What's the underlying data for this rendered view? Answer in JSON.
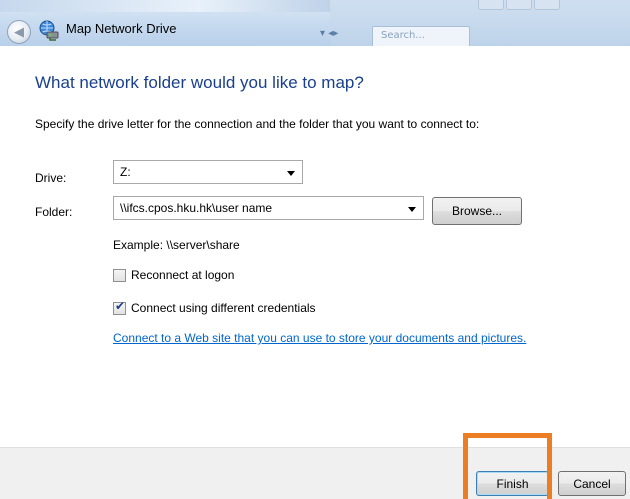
{
  "window": {
    "title": "Map Network Drive",
    "search_placeholder": "Search..."
  },
  "dialog": {
    "heading": "What network folder would you like to map?",
    "instruction": "Specify the drive letter for the connection and the folder that you want to connect to:",
    "drive": {
      "label": "Drive:",
      "value": "Z:"
    },
    "folder": {
      "label": "Folder:",
      "value": "\\\\ifcs.cpos.hku.hk\\user name",
      "browse_label": "Browse..."
    },
    "example": "Example: \\\\server\\share",
    "reconnect": {
      "label": "Reconnect at logon",
      "checked": false
    },
    "different_credentials": {
      "label": "Connect using different credentials",
      "checked": true
    },
    "web_link": "Connect to a Web site that you can use to store your documents and pictures."
  },
  "footer": {
    "finish_label": "Finish",
    "cancel_label": "Cancel"
  },
  "colors": {
    "heading": "#1a3f8f",
    "link": "#0066cc",
    "highlight": "#ec7d22"
  }
}
